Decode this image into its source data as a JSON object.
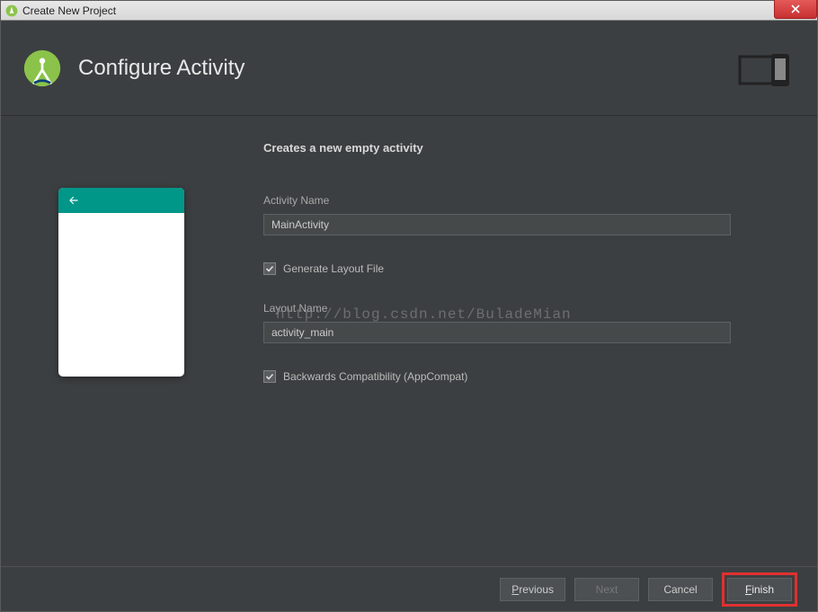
{
  "window": {
    "title": "Create New Project"
  },
  "header": {
    "title": "Configure Activity"
  },
  "form": {
    "heading": "Creates a new empty activity",
    "activity_name_label": "Activity Name",
    "activity_name_value": "MainActivity",
    "generate_layout_label": "Generate Layout File",
    "generate_layout_checked": true,
    "layout_name_label": "Layout Name",
    "layout_name_value": "activity_main",
    "backwards_compat_label": "Backwards Compatibility (AppCompat)",
    "backwards_compat_checked": true
  },
  "watermark": "http://blog.csdn.net/BuladeMian",
  "footer": {
    "previous": "Previous",
    "previous_u": "P",
    "previous_rest": "revious",
    "next": "Next",
    "cancel": "Cancel",
    "finish": "Finish",
    "finish_u": "F",
    "finish_rest": "inish"
  }
}
